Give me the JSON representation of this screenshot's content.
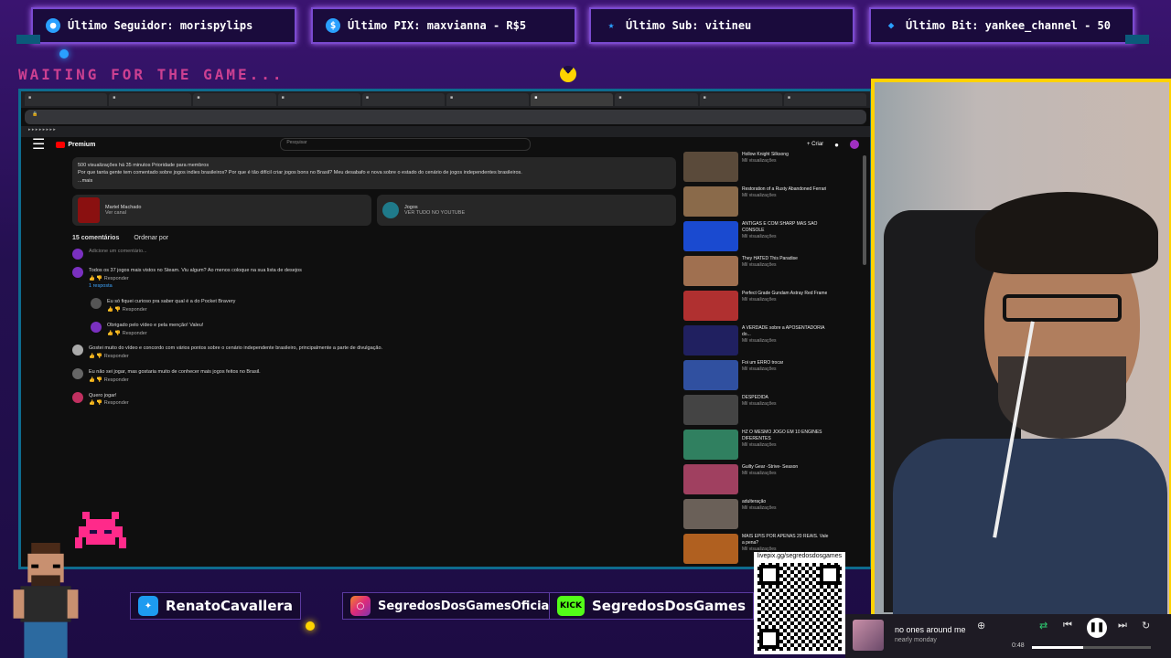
{
  "overlay": {
    "stats": [
      {
        "label": "Último Seguidor: morispylips",
        "icon": "user-icon",
        "color": "#2aa0ff"
      },
      {
        "label": "Último PIX: maxvianna - R$5",
        "icon": "dollar-icon",
        "color": "#2aa0ff"
      },
      {
        "label": "Último Sub: vitineu",
        "icon": "star-icon",
        "color": "#2aa0ff"
      },
      {
        "label": "Último Bit: yankee_channel - 50",
        "icon": "diamond-icon",
        "color": "#2aa0ff"
      }
    ],
    "waiting": "WAITING FOR THE GAME...",
    "social": {
      "twitter": "RenatoCavallera",
      "instagram": "SegredosDosGamesOficial",
      "kick_badge": "KICK",
      "kick": "SegredosDosGames"
    },
    "qr_url": "livepix.gg/segredosdosgames"
  },
  "browser": {
    "premium_label": "Premium",
    "search_placeholder": "Pesquisar",
    "create_label": "+ Criar",
    "description": {
      "line1": "500 visualizações há 35 minutos  Prioridade para membros",
      "line2": "Por que tanta gente tem comentado sobre jogos indies brasileiros? Por que é tão difícil criar jogos bons no Brasil? Meu desabafo e nova sobre o estado do cenário de jogos independentes brasileiros.",
      "more": "...mais"
    },
    "cards": [
      {
        "title": "Martel Machado",
        "sub": "Ver canal"
      },
      {
        "title": "Jogos",
        "sub": "VER TUDO NO YOUTUBE"
      }
    ],
    "comments_title": "15 comentários",
    "sort_label": "Ordenar por",
    "add_comment": "Adicione um comentário...",
    "comments": [
      {
        "text": "Todos os 37 jogos mais vistos no Steam. Viu algum? Ao menos coloque na sua lista de desejos",
        "actions": "Responder"
      },
      {
        "text": "Eu só fiquei curioso pra saber qual é a do Pocket Bravery",
        "actions": "Responder"
      },
      {
        "text": "Obrigado pelo vídeo e pela menção! Valeu!",
        "actions": "Responder"
      },
      {
        "text": "Gostei muito do vídeo e concordo com vários pontos sobre o cenário independente brasileiro, principalmente a parte de divulgação.",
        "actions": "Responder"
      },
      {
        "text": "Eu não sei jogar, mas gostaria muito de conhecer mais jogos feitos no Brasil.",
        "actions": "Responder"
      },
      {
        "text": "Quero jogar!",
        "actions": "Responder"
      }
    ],
    "replies_label": "1 resposta",
    "recommended": [
      {
        "title": "Hollow Knight Silksong",
        "meta": "Mil visualizações"
      },
      {
        "title": "Restoration of a Rusty Abandoned Ferrari",
        "meta": "Mil visualizações"
      },
      {
        "title": "ANTIGAS E COM SHARP MAS SÃO CONSOLE",
        "meta": "Mil visualizações"
      },
      {
        "title": "They HATED This Paradise",
        "meta": "Mil visualizações"
      },
      {
        "title": "Perfect Grade Gundam Astray Red Frame",
        "meta": "Mil visualizações"
      },
      {
        "title": "A VERDADE sobre a APOSENTADORIA do...",
        "meta": "Mil visualizações"
      },
      {
        "title": "Foi um ERRO trocar",
        "meta": "Mil visualizações"
      },
      {
        "title": "DESPEDIDA",
        "meta": "Mil visualizações"
      },
      {
        "title": "HZ O MESMO JOGO EM 10 ENGINES DIFERENTES",
        "meta": "Mil visualizações"
      },
      {
        "title": "Guilty Gear -Strive- Season",
        "meta": "Mil visualizações"
      },
      {
        "title": "adulteração",
        "meta": "Mil visualizações"
      },
      {
        "title": "MAIS EPIS POR APENAS 20 REAIS. Vale a pena?",
        "meta": "Mil visualizações"
      }
    ]
  },
  "player": {
    "song": "no ones around me",
    "artist": "nearly monday",
    "time": "0:48",
    "progress": 0.43
  }
}
